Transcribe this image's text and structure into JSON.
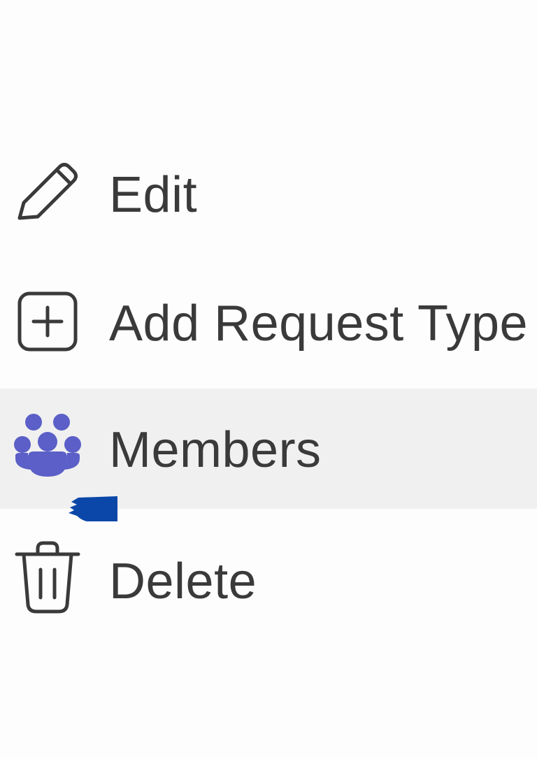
{
  "menu": {
    "items": [
      {
        "label": "Edit",
        "icon": "pencil-icon"
      },
      {
        "label": "Add Request Type",
        "icon": "plus-square-icon"
      },
      {
        "label": "Members",
        "icon": "people-group-icon",
        "highlighted": true
      },
      {
        "label": "Delete",
        "icon": "trash-icon"
      }
    ]
  },
  "colors": {
    "background": "#fdfdfd",
    "hover_background": "#f0f0f0",
    "text": "#3a3a3a",
    "icon_stroke": "#3a3a3a",
    "members_icon": "#5b5fc7",
    "cursor_mark": "#0a47a8"
  }
}
